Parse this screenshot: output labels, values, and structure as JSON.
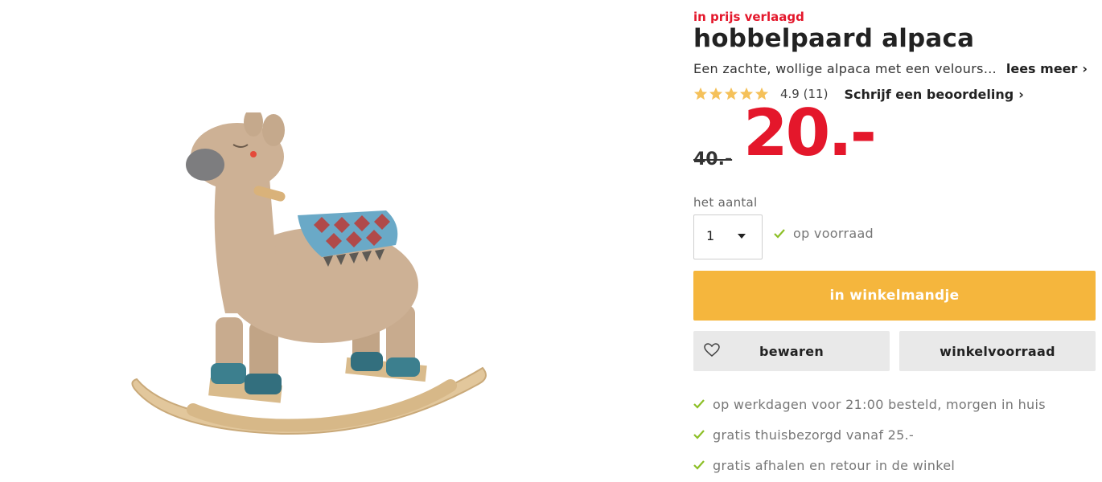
{
  "product": {
    "badge": "in prijs verlaagd",
    "title": "hobbelpaard alpaca",
    "description": "Een zachte, wollige alpaca met een velours zadel om op te hobbelen",
    "read_more": "lees meer",
    "rating": {
      "value": "4.9",
      "count": "(11)",
      "stars": 5,
      "star_color": "#f5c15a"
    },
    "review_link": "Schrijf een beoordeling",
    "old_price": "40.-",
    "new_price": "20.-",
    "price_color": "#e4172b"
  },
  "purchase": {
    "quantity_label": "het aantal",
    "quantity_value": "1",
    "stock_status": "op voorraad",
    "add_to_cart": "in winkelmandje",
    "save": "bewaren",
    "store_stock": "winkelvoorraad",
    "cart_color": "#f5b63d",
    "check_color": "#8cbf26"
  },
  "usps": [
    "op werkdagen voor 21:00 besteld, morgen in huis",
    "gratis thuisbezorgd vanaf 25.-",
    "gratis afhalen en retour in de winkel"
  ],
  "icons": [
    "star-icon",
    "chevron-right-icon",
    "caret-down-icon",
    "checkmark-icon",
    "heart-icon"
  ]
}
